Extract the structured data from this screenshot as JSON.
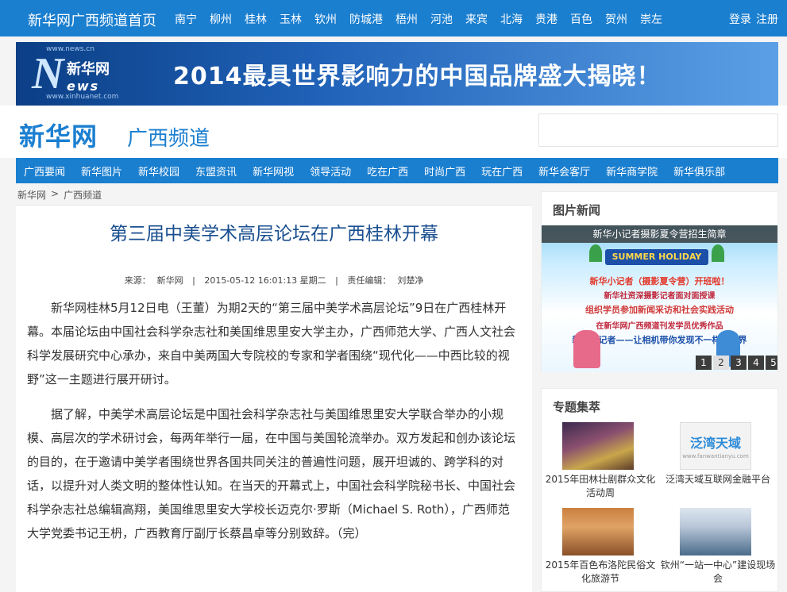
{
  "topbar": {
    "site_title": "新华网广西频道首页",
    "cities": [
      "南宁",
      "柳州",
      "桂林",
      "玉林",
      "钦州",
      "防城港",
      "梧州",
      "河池",
      "来宾",
      "北海",
      "贵港",
      "百色",
      "贺州",
      "崇左"
    ],
    "login": "登录",
    "register": "注册"
  },
  "banner": {
    "logo_cn": "新华网",
    "logo_en_n": "N",
    "logo_en_rest": "ews",
    "logo_url_top": "www.news.cn",
    "logo_url_bot": "www.xinhuanet.com",
    "headline": "2014最具世界影响力的中国品牌盛大揭晓！"
  },
  "brand": {
    "name": "新华网",
    "channel": "广西频道"
  },
  "nav": {
    "items": [
      "广西要闻",
      "新华图片",
      "新华校园",
      "东盟资讯",
      "新华网视",
      "领导活动",
      "吃在广西",
      "时尚广西",
      "玩在广西",
      "新华会客厅",
      "新华商学院",
      "新华俱乐部"
    ]
  },
  "breadcrumb": {
    "home": "新华网",
    "sep": ">",
    "current": "广西频道"
  },
  "article": {
    "title": "第三届中美学术高层论坛在广西桂林开幕",
    "source_label": "来源：",
    "source": "新华网",
    "divider": "|",
    "datetime": "2015-05-12 16:01:13 星期二",
    "editor_label": "责任编辑：",
    "editor": "刘楚净",
    "paragraphs": [
      "新华网桂林5月12日电（王董）为期2天的“第三届中美学术高层论坛”9日在广西桂林开幕。本届论坛由中国社会科学杂志社和美国维思里安大学主办，广西师范大学、广西人文社会科学发展研究中心承办，来自中美两国大专院校的专家和学者围绕“现代化——中西比较的视野”这一主题进行展开研讨。",
      "据了解，中美学术高层论坛是中国社会科学杂志社与美国维思里安大学联合举办的小规模、高层次的学术研讨会，每两年举行一届，在中国与美国轮流举办。双方发起和创办该论坛的目的，在于邀请中美学者围绕世界各国共同关注的普遍性问题，展开坦诚的、跨学科的对话，以提升对人类文明的整体性认知。在当天的开幕式上，中国社会科学院秘书长、中国社会科学杂志社总编辑高翔，美国维思里安大学校长迈克尔·罗斯（Michael S. Roth），广西师范大学党委书记王枬，广西教育厅副厅长蔡昌卓等分别致辞。（完）"
    ]
  },
  "photo_news": {
    "title": "图片新闻",
    "caption": "新华小记者摄影夏令营招生简章",
    "poster": {
      "badge": "SUMMER HOLIDAY",
      "lines": [
        "新华小记者（摄影夏令营）开班啦！",
        "新华社资深摄影记者面对面授课",
        "组织学员参加新闻采访和社会实践活动",
        "在新华网广西频道刊发学员优秀作品",
        "新华小记者——让相机带你发现不一样的世界"
      ]
    },
    "pages": [
      "1",
      "2",
      "3",
      "4",
      "5"
    ],
    "active_page": "2"
  },
  "topics": {
    "title": "专题集萃",
    "items": [
      {
        "caption": "2015年田林壮剧群众文化活动周"
      },
      {
        "caption": "泛湾天域互联网金融平台",
        "thumb_text": "泛湾天域",
        "thumb_url": "www.fanwantianyu.com"
      },
      {
        "caption": "2015年百色布洛陀民俗文化旅游节"
      },
      {
        "caption": "钦州“一站一中心”建设现场会"
      }
    ]
  },
  "colors": {
    "primary_blue": "#1b7fd0",
    "title_blue": "#1a4f8f"
  }
}
